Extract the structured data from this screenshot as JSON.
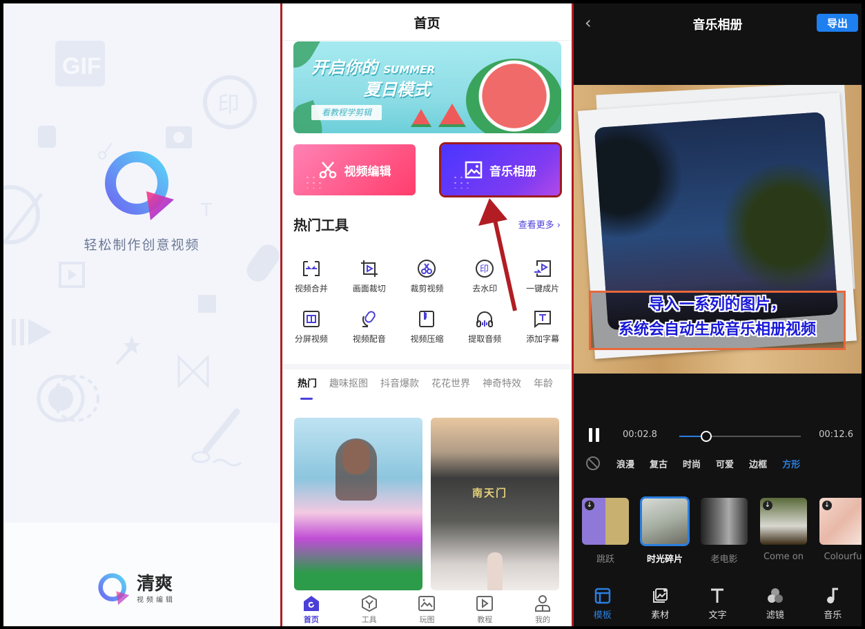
{
  "splash": {
    "slogan": "轻松制作创意视频",
    "brand_name": "清爽",
    "brand_sub": "视频编辑",
    "background_icons": [
      "gif-icon",
      "watermark-icon",
      "store-icon",
      "camera-icon",
      "scissors-icon",
      "text-size-icon",
      "face-icon",
      "microphone-icon",
      "video-crop-icon",
      "image-icon",
      "play-icon",
      "magic-wand-icon",
      "bowtie-icon",
      "lens-icon",
      "brush-icon"
    ]
  },
  "home": {
    "title": "首页",
    "banner": {
      "line1": "开启你的",
      "line1_en": "SUMMER",
      "line2": "夏日模式",
      "button": "看教程学剪辑"
    },
    "feature_buttons": [
      {
        "label": "视频编辑",
        "icon": "scissors-icon"
      },
      {
        "label": "音乐相册",
        "icon": "image-icon",
        "highlighted": true
      }
    ],
    "section_title": "热门工具",
    "see_more": "查看更多 ›",
    "tools": [
      {
        "label": "视频合并",
        "icon": "merge-icon"
      },
      {
        "label": "画面裁切",
        "icon": "crop-icon"
      },
      {
        "label": "裁剪视频",
        "icon": "cut-video-icon"
      },
      {
        "label": "去水印",
        "icon": "remove-watermark-icon"
      },
      {
        "label": "一键成片",
        "icon": "one-click-video-icon"
      },
      {
        "label": "分屏视频",
        "icon": "split-screen-icon"
      },
      {
        "label": "视频配音",
        "icon": "dubbing-icon"
      },
      {
        "label": "视频压缩",
        "icon": "compress-icon"
      },
      {
        "label": "提取音频",
        "icon": "headphones-icon"
      },
      {
        "label": "添加字幕",
        "icon": "subtitle-icon"
      }
    ],
    "category_tabs": [
      "热门",
      "趣味抠图",
      "抖音爆款",
      "花花世界",
      "神奇特效",
      "年龄"
    ],
    "active_tab": 0,
    "cards": [
      {
        "label": "lily-portrait-card"
      },
      {
        "label": "南天门"
      }
    ],
    "tabbar": [
      {
        "label": "首页",
        "icon": "home-icon",
        "active": true
      },
      {
        "label": "工具",
        "icon": "toolbox-icon"
      },
      {
        "label": "玩图",
        "icon": "picture-icon"
      },
      {
        "label": "教程",
        "icon": "tutorial-icon"
      },
      {
        "label": "我的",
        "icon": "profile-icon"
      }
    ],
    "annotation_color": "#b11d23"
  },
  "editor": {
    "title": "音乐相册",
    "back": "‹",
    "export_label": "导出",
    "caption_line1": "导入一系列的图片，",
    "caption_line2": "系统会自动生成音乐相册视频",
    "current_time": "00:02.8",
    "total_time": "00:12.6",
    "progress": 0.22,
    "styles": [
      "浪漫",
      "复古",
      "时尚",
      "可爱",
      "边框",
      "方形"
    ],
    "active_style": 5,
    "templates": [
      {
        "label": "跳跃",
        "download": true
      },
      {
        "label": "时光碎片",
        "selected": true
      },
      {
        "label": "老电影"
      },
      {
        "label": "Come on",
        "download": true
      },
      {
        "label": "Colourfu",
        "download": true
      }
    ],
    "bottom_nav": [
      {
        "label": "模板",
        "icon": "template-icon",
        "active": true
      },
      {
        "label": "素材",
        "icon": "material-icon"
      },
      {
        "label": "文字",
        "icon": "text-icon"
      },
      {
        "label": "滤镜",
        "icon": "filter-icon"
      },
      {
        "label": "音乐",
        "icon": "music-note-icon"
      }
    ],
    "accent": "#2a7fe0"
  }
}
